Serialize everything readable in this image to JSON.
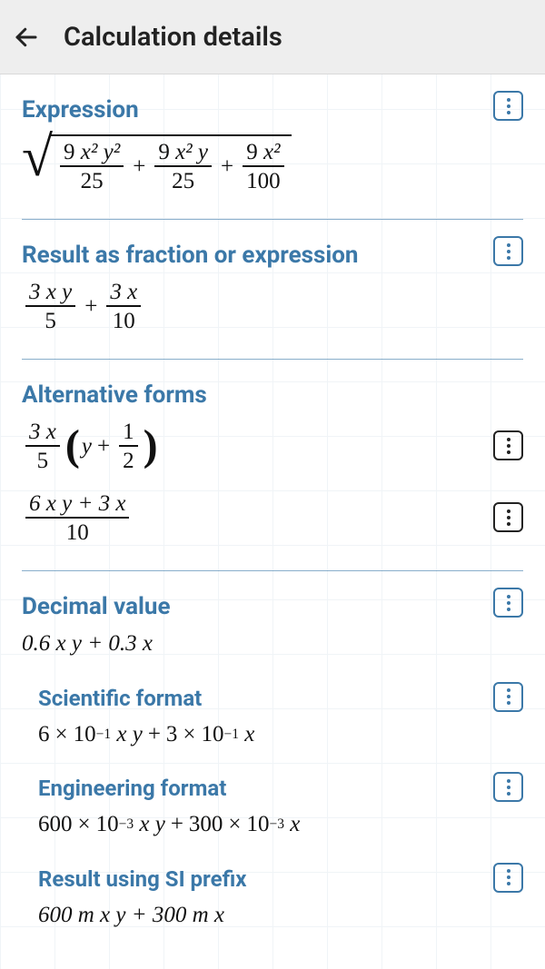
{
  "topbar": {
    "title": "Calculation details"
  },
  "expression": {
    "heading": "Expression",
    "terms": [
      {
        "num_coeff": "9",
        "num_vars": "x² y²",
        "den": "25"
      },
      {
        "num_coeff": "9",
        "num_vars": "x² y",
        "den": "25"
      },
      {
        "num_coeff": "9",
        "num_vars": "x²",
        "den": "100"
      }
    ]
  },
  "fraction_result": {
    "heading": "Result as fraction or expression",
    "terms": [
      {
        "num": "3 x y",
        "den": "5"
      },
      {
        "num": "3 x",
        "den": "10"
      }
    ]
  },
  "alternative": {
    "heading": "Alternative forms",
    "form1": {
      "lead_num": "3 x",
      "lead_den": "5",
      "inside_var": "y",
      "inside_frac_num": "1",
      "inside_frac_den": "2"
    },
    "form2": {
      "num": "6 x y + 3 x",
      "den": "10"
    }
  },
  "decimal": {
    "heading": "Decimal value",
    "value": "0.6 x y + 0.3 x"
  },
  "scientific": {
    "heading": "Scientific format",
    "t1_m": "6",
    "t1_exp": "−1",
    "t1_var": "x y",
    "t2_m": "3",
    "t2_exp": "−1",
    "t2_var": "x"
  },
  "engineering": {
    "heading": "Engineering format",
    "t1_m": "600",
    "t1_exp": "−3",
    "t1_var": "x y",
    "t2_m": "300",
    "t2_exp": "−3",
    "t2_var": "x"
  },
  "si": {
    "heading": "Result using SI prefix",
    "value": "600 m x y + 300 m x"
  }
}
